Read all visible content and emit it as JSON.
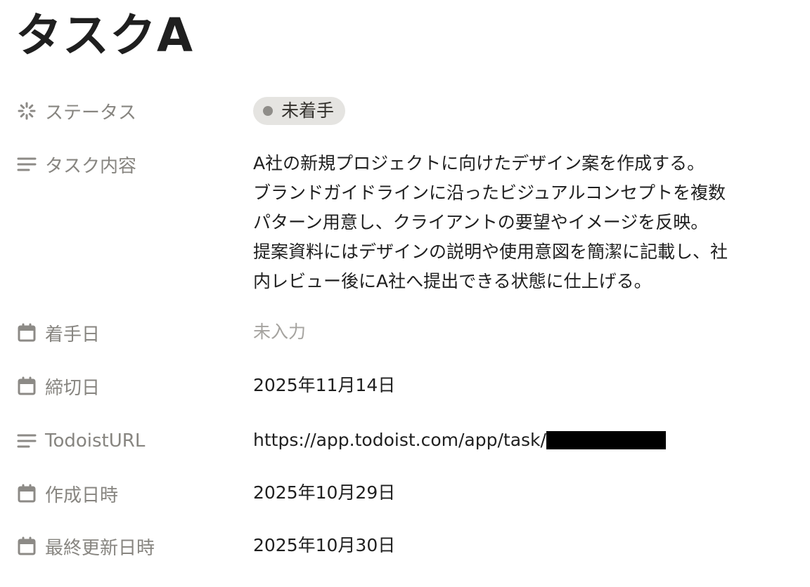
{
  "page": {
    "title": "タスクA"
  },
  "properties": {
    "status": {
      "label": "ステータス",
      "icon": "status-spinner-icon",
      "value": "未着手",
      "badge_color": "#e5e4e1",
      "dot_color": "#8f8d89"
    },
    "task_content": {
      "label": "タスク内容",
      "icon": "text-lines-icon",
      "lines": [
        "A社の新規プロジェクトに向けたデザイン案を作成する。",
        "ブランドガイドラインに沿ったビジュアルコンセプトを複数",
        "パターン用意し、クライアントの要望やイメージを反映。",
        "提案資料にはデザインの説明や使用意図を簡潔に記載し、社",
        "内レビュー後にA社へ提出できる状態に仕上げる。"
      ]
    },
    "start_date": {
      "label": "着手日",
      "icon": "calendar-icon",
      "value": "未入力"
    },
    "deadline": {
      "label": "締切日",
      "icon": "calendar-icon",
      "value": "2025年11月14日"
    },
    "todoist_url": {
      "label": "TodoistURL",
      "icon": "text-lines-icon",
      "value": "https://app.todoist.com/app/task/"
    },
    "created_at": {
      "label": "作成日時",
      "icon": "calendar-icon",
      "value": "2025年10月29日"
    },
    "updated_at": {
      "label": "最終更新日時",
      "icon": "calendar-icon",
      "value": "2025年10月30日"
    }
  },
  "colors": {
    "text": "#1f1f1f",
    "label": "#878580",
    "placeholder": "#a5a39f",
    "icon": "#8c8a86"
  }
}
